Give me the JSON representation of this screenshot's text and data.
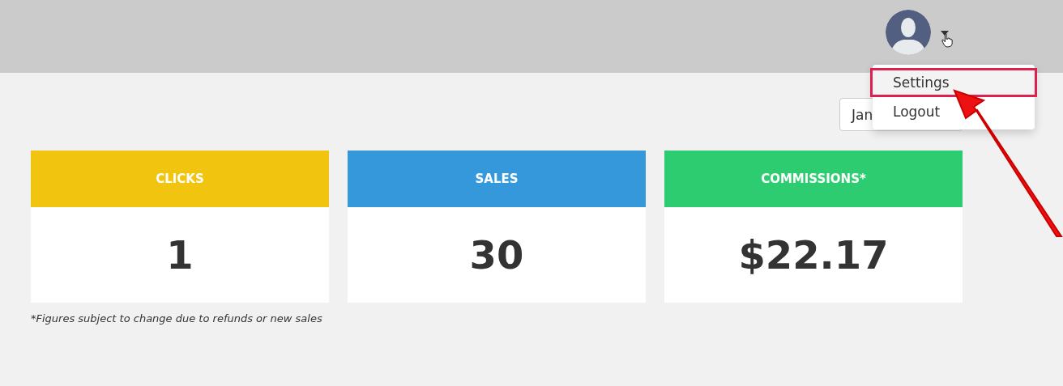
{
  "user_menu": {
    "expanded": true,
    "items": [
      {
        "label": "Settings",
        "highlighted": true
      },
      {
        "label": "Logout",
        "highlighted": false
      }
    ]
  },
  "date_filter": {
    "value": "Jan"
  },
  "stats": [
    {
      "title": "CLICKS",
      "value": "1",
      "color": "#f1c40f"
    },
    {
      "title": "SALES",
      "value": "30",
      "color": "#3498db"
    },
    {
      "title": "COMMISSIONS*",
      "value": "$22.17",
      "color": "#2ecc71"
    }
  ],
  "footnote": "*Figures subject to change due to refunds or new sales"
}
